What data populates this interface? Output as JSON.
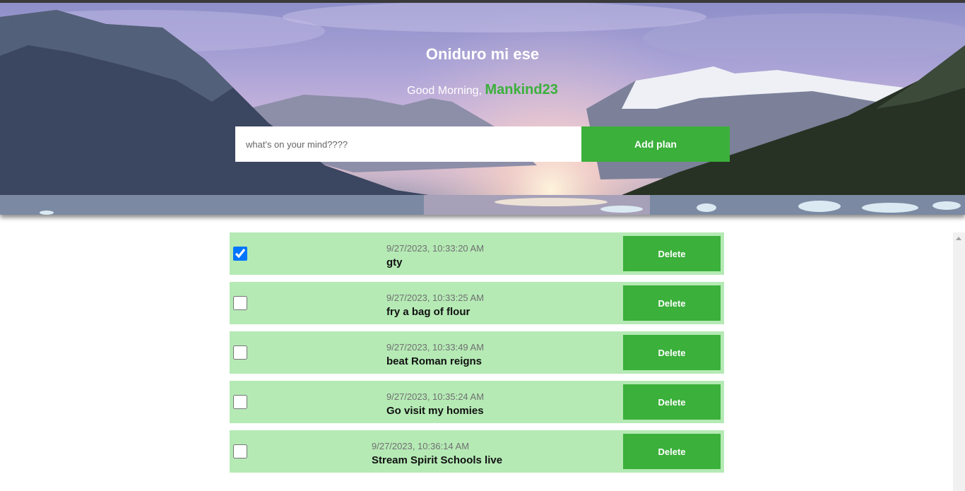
{
  "header": {
    "title": "Oniduro mi ese",
    "greeting": "Good Morning,",
    "username": "Mankind23"
  },
  "input": {
    "placeholder": "what's on your mind????",
    "value": ""
  },
  "add_button": "Add plan",
  "tasks": [
    {
      "timestamp": "9/27/2023, 10:33:20 AM",
      "text": "gty",
      "checked": true,
      "delete_label": "Delete"
    },
    {
      "timestamp": "9/27/2023, 10:33:25 AM",
      "text": "fry a bag of flour",
      "checked": false,
      "delete_label": "Delete"
    },
    {
      "timestamp": "9/27/2023, 10:33:49 AM",
      "text": "beat Roman reigns",
      "checked": false,
      "delete_label": "Delete"
    },
    {
      "timestamp": "9/27/2023, 10:35:24 AM",
      "text": "Go visit my homies",
      "checked": false,
      "delete_label": "Delete"
    },
    {
      "timestamp": "9/27/2023, 10:36:14 AM",
      "text": "Stream Spirit Schools live",
      "checked": false,
      "delete_label": "Delete"
    }
  ],
  "colors": {
    "accent": "#3bb03b",
    "row_background": "#b5eab5"
  }
}
